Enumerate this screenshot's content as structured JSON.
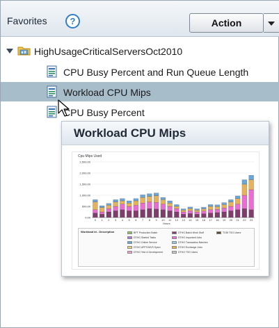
{
  "header": {
    "title": "Favorites",
    "help_glyph": "?",
    "action_label": "Action"
  },
  "tree": {
    "folder": {
      "label": "HighUsageCriticalServersOct2010",
      "expanded": true
    },
    "items": [
      {
        "label": "CPU Busy Percent and Run Queue Length",
        "selected": false
      },
      {
        "label": "Workload CPU Mips",
        "selected": true
      },
      {
        "label": "CPU Busy Percent",
        "selected": false
      }
    ]
  },
  "preview": {
    "title": "Workload CPU Mips",
    "thumbnail": {
      "chart_title": "Cpu Mips Used",
      "y_ticks": [
        "2,500.00",
        "2,000.00",
        "1,500.00",
        "1,000.00",
        "500.00",
        "0.00"
      ],
      "x_label": "Hours",
      "legend_header": "Workload Id - Description",
      "legend": [
        {
          "label": "BPT Production Batch",
          "color": "#8fbf6f"
        },
        {
          "label": "DTHG Started Tasks",
          "color": "#b07ad0"
        },
        {
          "label": "DTHG Online Service",
          "color": "#6aa6d8"
        },
        {
          "label": "DTHG APPC/MVS Sysm",
          "color": "#e8d07c"
        },
        {
          "label": "DTHG Test & Development",
          "color": "#f0a0c8"
        },
        {
          "label": "DTHG Batch Work Stuff",
          "color": "#7e3d6b"
        },
        {
          "label": "DTHG Important Jobs",
          "color": "#e86fd1"
        },
        {
          "label": "DTHG Transaction Batches",
          "color": "#9cc7e0"
        },
        {
          "label": "DTHG Exchange Jobs",
          "color": "#e5b35e"
        },
        {
          "label": "DTHG TSO Users",
          "color": "#c9c9c9"
        },
        {
          "label": "TCBI TSO Users",
          "color": "#5a4a2a"
        }
      ]
    }
  },
  "chart_data": {
    "type": "bar",
    "title": "Cpu Mips Used",
    "xlabel": "Hours",
    "ylabel": "",
    "ylim": [
      0,
      2500
    ],
    "categories": [
      "0",
      "1",
      "2",
      "3",
      "4",
      "5",
      "6",
      "7",
      "8",
      "9",
      "10",
      "11",
      "12",
      "13",
      "14",
      "15",
      "16",
      "17",
      "18",
      "19",
      "20",
      "21",
      "22",
      "23"
    ],
    "series": [
      {
        "name": "DTHG Batch Work Stuff",
        "values": [
          200,
          150,
          250,
          300,
          350,
          300,
          300,
          350,
          400,
          380,
          350,
          300,
          250,
          150,
          180,
          150,
          170,
          200,
          220,
          250,
          300,
          350,
          400,
          350
        ]
      },
      {
        "name": "DTHG Important Jobs",
        "values": [
          150,
          100,
          150,
          200,
          250,
          200,
          250,
          300,
          300,
          300,
          250,
          200,
          150,
          100,
          120,
          100,
          120,
          150,
          150,
          180,
          200,
          250,
          600,
          900
        ]
      },
      {
        "name": "DTHG Exchange Jobs",
        "values": [
          350,
          200,
          150,
          200,
          150,
          150,
          200,
          250,
          250,
          300,
          200,
          150,
          100,
          80,
          100,
          80,
          100,
          150,
          120,
          150,
          200,
          250,
          500,
          450
        ]
      },
      {
        "name": "DTHG Online Service",
        "values": [
          100,
          80,
          80,
          100,
          100,
          100,
          100,
          120,
          120,
          120,
          100,
          100,
          80,
          60,
          70,
          60,
          70,
          80,
          80,
          90,
          100,
          120,
          200,
          200
        ]
      }
    ]
  },
  "colors": {
    "selected_row": "#a7bdca",
    "help_icon": "#2f7fc6"
  }
}
